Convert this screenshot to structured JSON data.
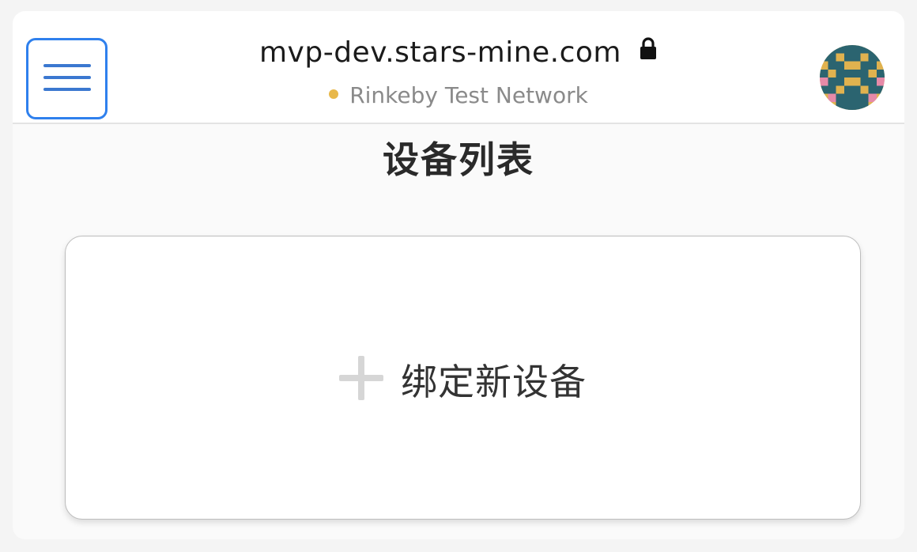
{
  "header": {
    "url": "mvp-dev.stars-mine.com",
    "network": "Rinkeby Test Network",
    "network_status_color": "#e8b84a",
    "menu_icon": "hamburger-menu-icon",
    "secure_icon": "lock-icon",
    "accent_color": "#2f80ed"
  },
  "page": {
    "title": "设备列表"
  },
  "bind_card": {
    "label": "绑定新设备",
    "icon": "plus-icon"
  }
}
